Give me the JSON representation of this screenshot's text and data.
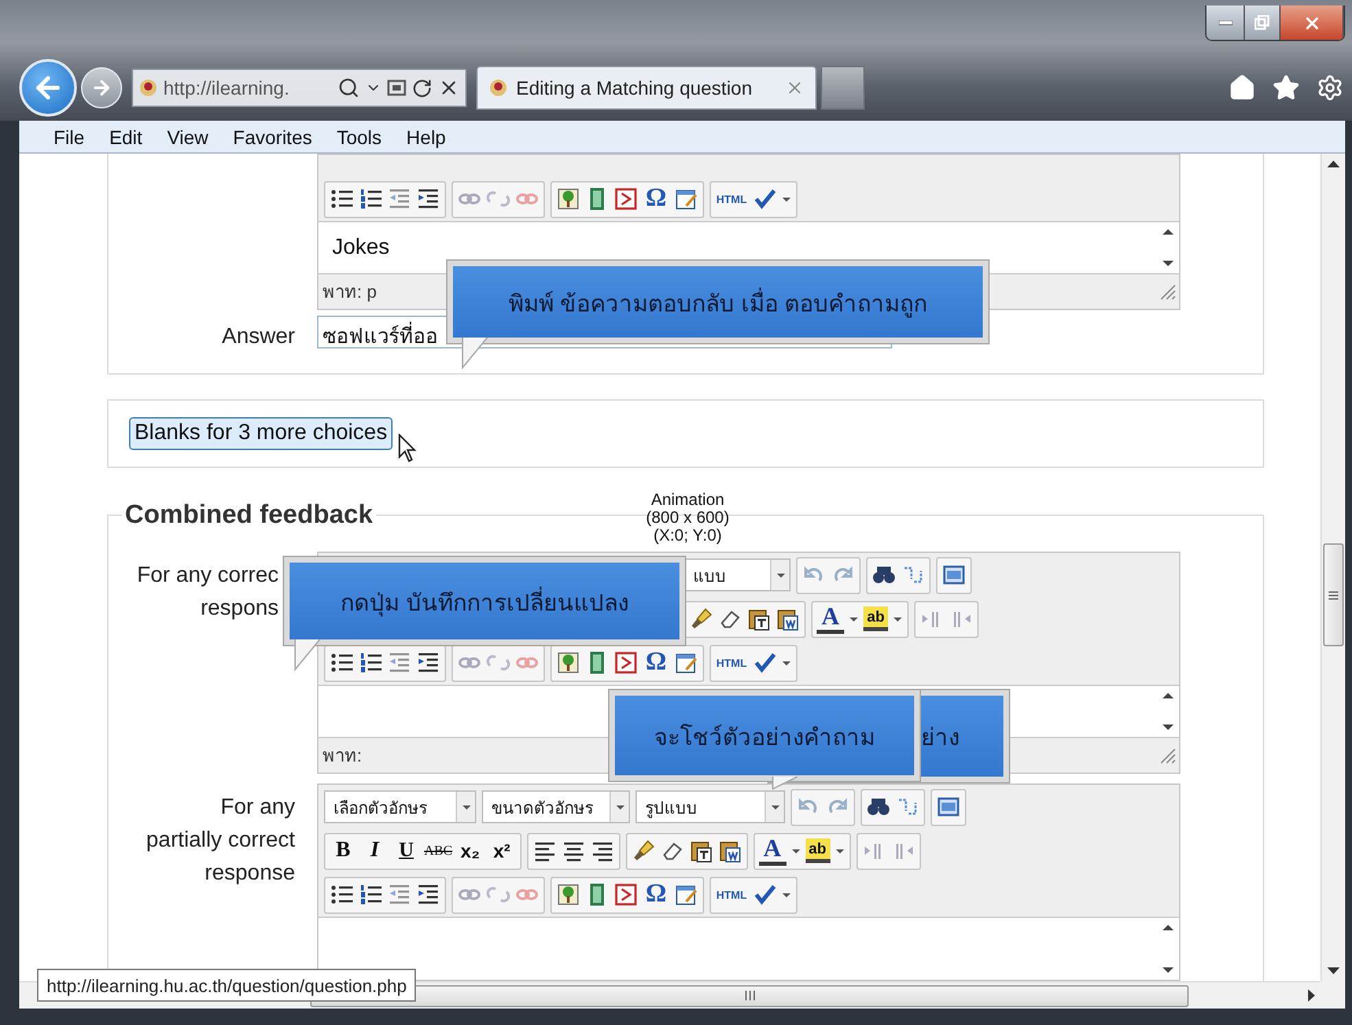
{
  "browser": {
    "address": "http://ilearning.",
    "tabs": [
      {
        "title": "Editing a Matching question",
        "selected": true
      }
    ]
  },
  "menu": [
    "File",
    "Edit",
    "View",
    "Favorites",
    "Tools",
    "Help"
  ],
  "sections": [
    {
      "kind": "answer",
      "editor": {
        "rows": [
          {
            "kind": "insert",
            "labels": [
              "Ω",
              "HTML"
            ]
          }
        ],
        "content": "Jokes",
        "path": "พาท: p"
      },
      "answer": {
        "label": "Answer",
        "value": "ซอฟแวร์ที่ออ"
      }
    },
    {
      "kind": "blanks",
      "button": "Blanks for 3 more choices"
    },
    {
      "kind": "feedback",
      "legend": "Combined feedback",
      "tooltip": [
        "Animation",
        "(800 x 600)",
        "(X:0; Y:0)"
      ],
      "fields": [
        {
          "label": [
            "For any correc",
            "respons"
          ],
          "editor": {
            "covered": true,
            "rows": [
              {
                "kind": "font",
                "dropdowns": [
                  "แบบ"
                ]
              },
              {
                "kind": "format",
                "labels": [
                  "A",
                  "ab"
                ]
              },
              {
                "kind": "insert",
                "labels": [
                  "Ω",
                  "HTML"
                ]
              }
            ],
            "path": "พาท:"
          }
        },
        {
          "label": [
            "For any",
            "partially correct",
            "response"
          ],
          "editor": {
            "covered": false,
            "rows": [
              {
                "kind": "font",
                "dropdowns": [
                  "เลือกตัวอักษร",
                  "ขนาดตัวอักษร",
                  "รูปแบบ"
                ]
              },
              {
                "kind": "format",
                "labels": [
                  "B",
                  "I",
                  "U",
                  "ABC",
                  "x₂",
                  "x²",
                  "A",
                  "ab"
                ]
              },
              {
                "kind": "insert",
                "labels": [
                  "Ω",
                  "HTML"
                ]
              }
            ]
          }
        }
      ]
    }
  ],
  "callouts": [
    {
      "text": "พิมพ์ ข้อความตอบกลับ เมื่อ ตอบคำถามถูก"
    },
    {
      "text": "กดปุ่ม บันทึกการเปลี่ยนแปลง"
    },
    {
      "text": "ย่าง"
    },
    {
      "text": "จะโชว์ตัวอย่างคำถาม"
    }
  ],
  "status_url": "http://ilearning.hu.ac.th/question/question.php"
}
